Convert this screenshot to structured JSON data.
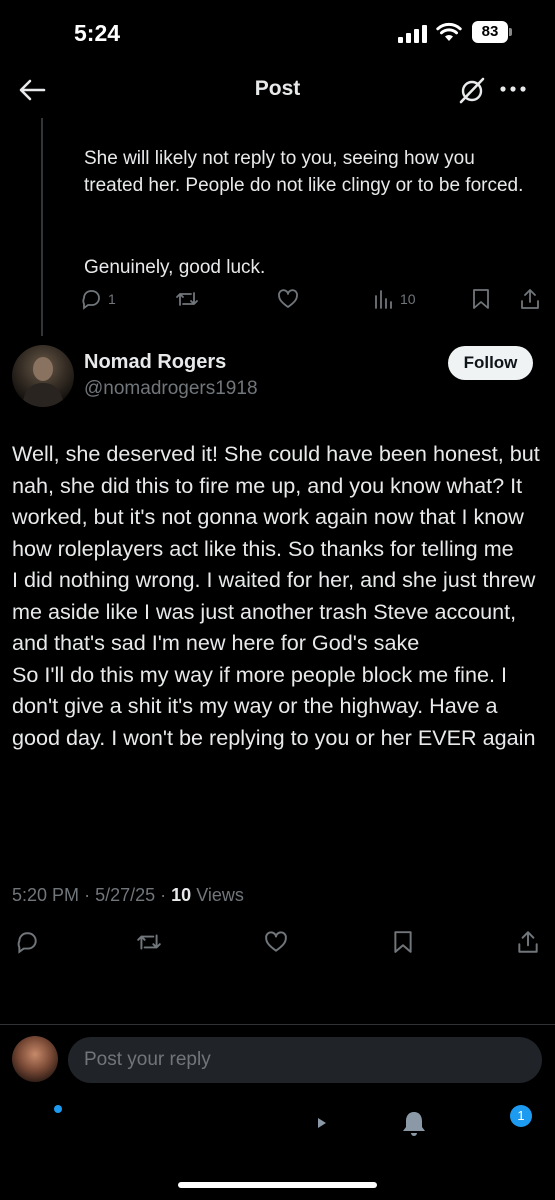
{
  "status_bar": {
    "time": "5:24",
    "battery": "83"
  },
  "header": {
    "title": "Post"
  },
  "parent_post": {
    "paragraph1": "She will likely not reply to you, seeing how you treated her. People do not like clingy or to be forced.",
    "paragraph2": "Genuinely, good luck.",
    "reply_count": "1",
    "view_count": "10"
  },
  "post": {
    "author_name": "Nomad Rogers",
    "handle": "@nomadrogers1918",
    "follow_label": "Follow",
    "text": "Well, she deserved it! She could have been honest, but nah, she did this to fire me up, and you know what? It worked, but it's not gonna work again now that I know how roleplayers act like this. So thanks for telling me\nI did nothing wrong. I waited for her, and she just threw me aside like I was just another trash Steve account, and that's sad I'm new here for God's sake\nSo I'll do this my way if more people block me fine. I don't give a shit it's my way or the highway. Have a good day. I won't be replying to you or her EVER again",
    "time": "5:20 PM",
    "date": "5/27/25",
    "views_count": "10",
    "views_label": "Views"
  },
  "reply": {
    "placeholder": "Post your reply"
  },
  "nav": {
    "messages_badge": "1"
  },
  "colors": {
    "background": "#000000",
    "text": "#e7e9ea",
    "muted": "#71767b",
    "accent": "#1d9bf0"
  }
}
